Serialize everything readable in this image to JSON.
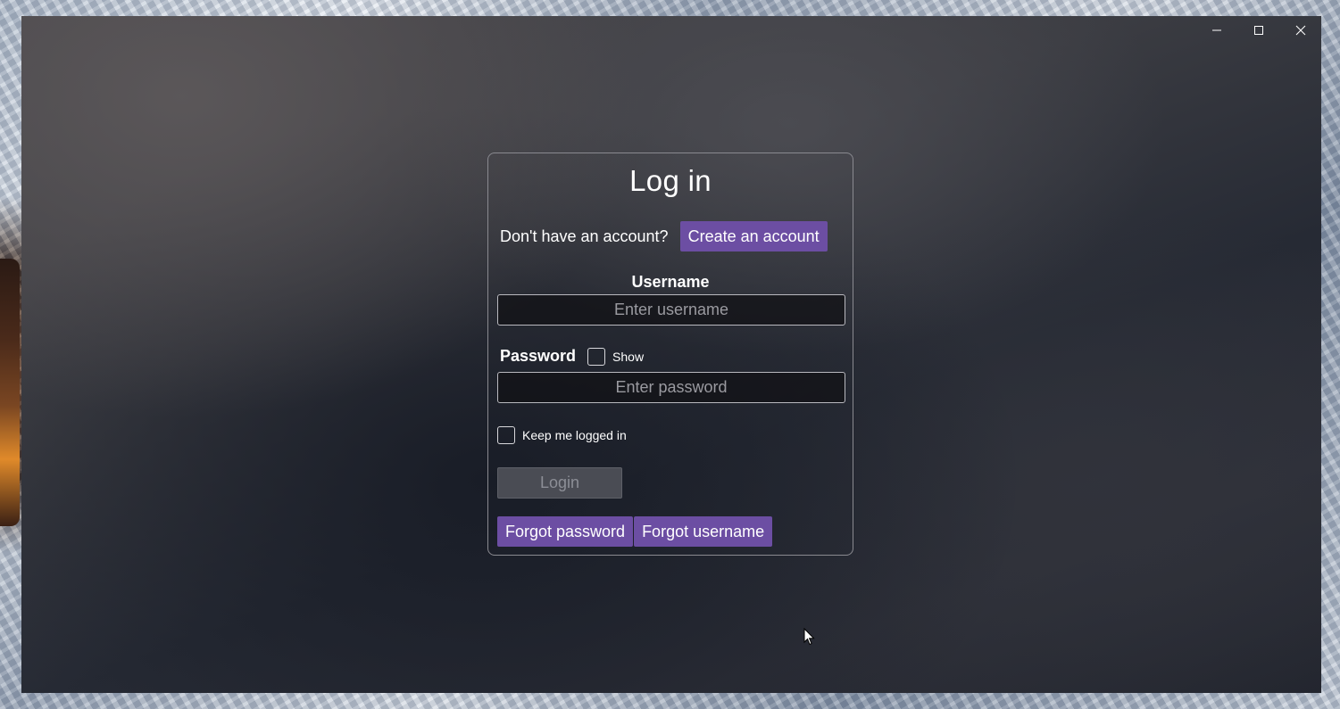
{
  "window": {
    "controls": {
      "minimize_icon": "minimize-icon",
      "maximize_icon": "maximize-icon",
      "close_icon": "close-icon"
    }
  },
  "login": {
    "title": "Log in",
    "account_question": "Don't have an account?",
    "create_account_label": "Create an account",
    "username_label": "Username",
    "username_placeholder": "Enter username",
    "username_value": "",
    "password_label": "Password",
    "show_password_label": "Show",
    "show_password_checked": false,
    "password_placeholder": "Enter password",
    "password_value": "",
    "keep_logged_in_label": "Keep me logged in",
    "keep_logged_in_checked": false,
    "login_label": "Login",
    "login_enabled": false,
    "forgot_password_label": "Forgot password",
    "forgot_username_label": "Forgot username"
  },
  "colors": {
    "accent_purple": "#6c4ea3",
    "disabled_button": "#4a4c54",
    "card_border": "#8a8a90"
  }
}
